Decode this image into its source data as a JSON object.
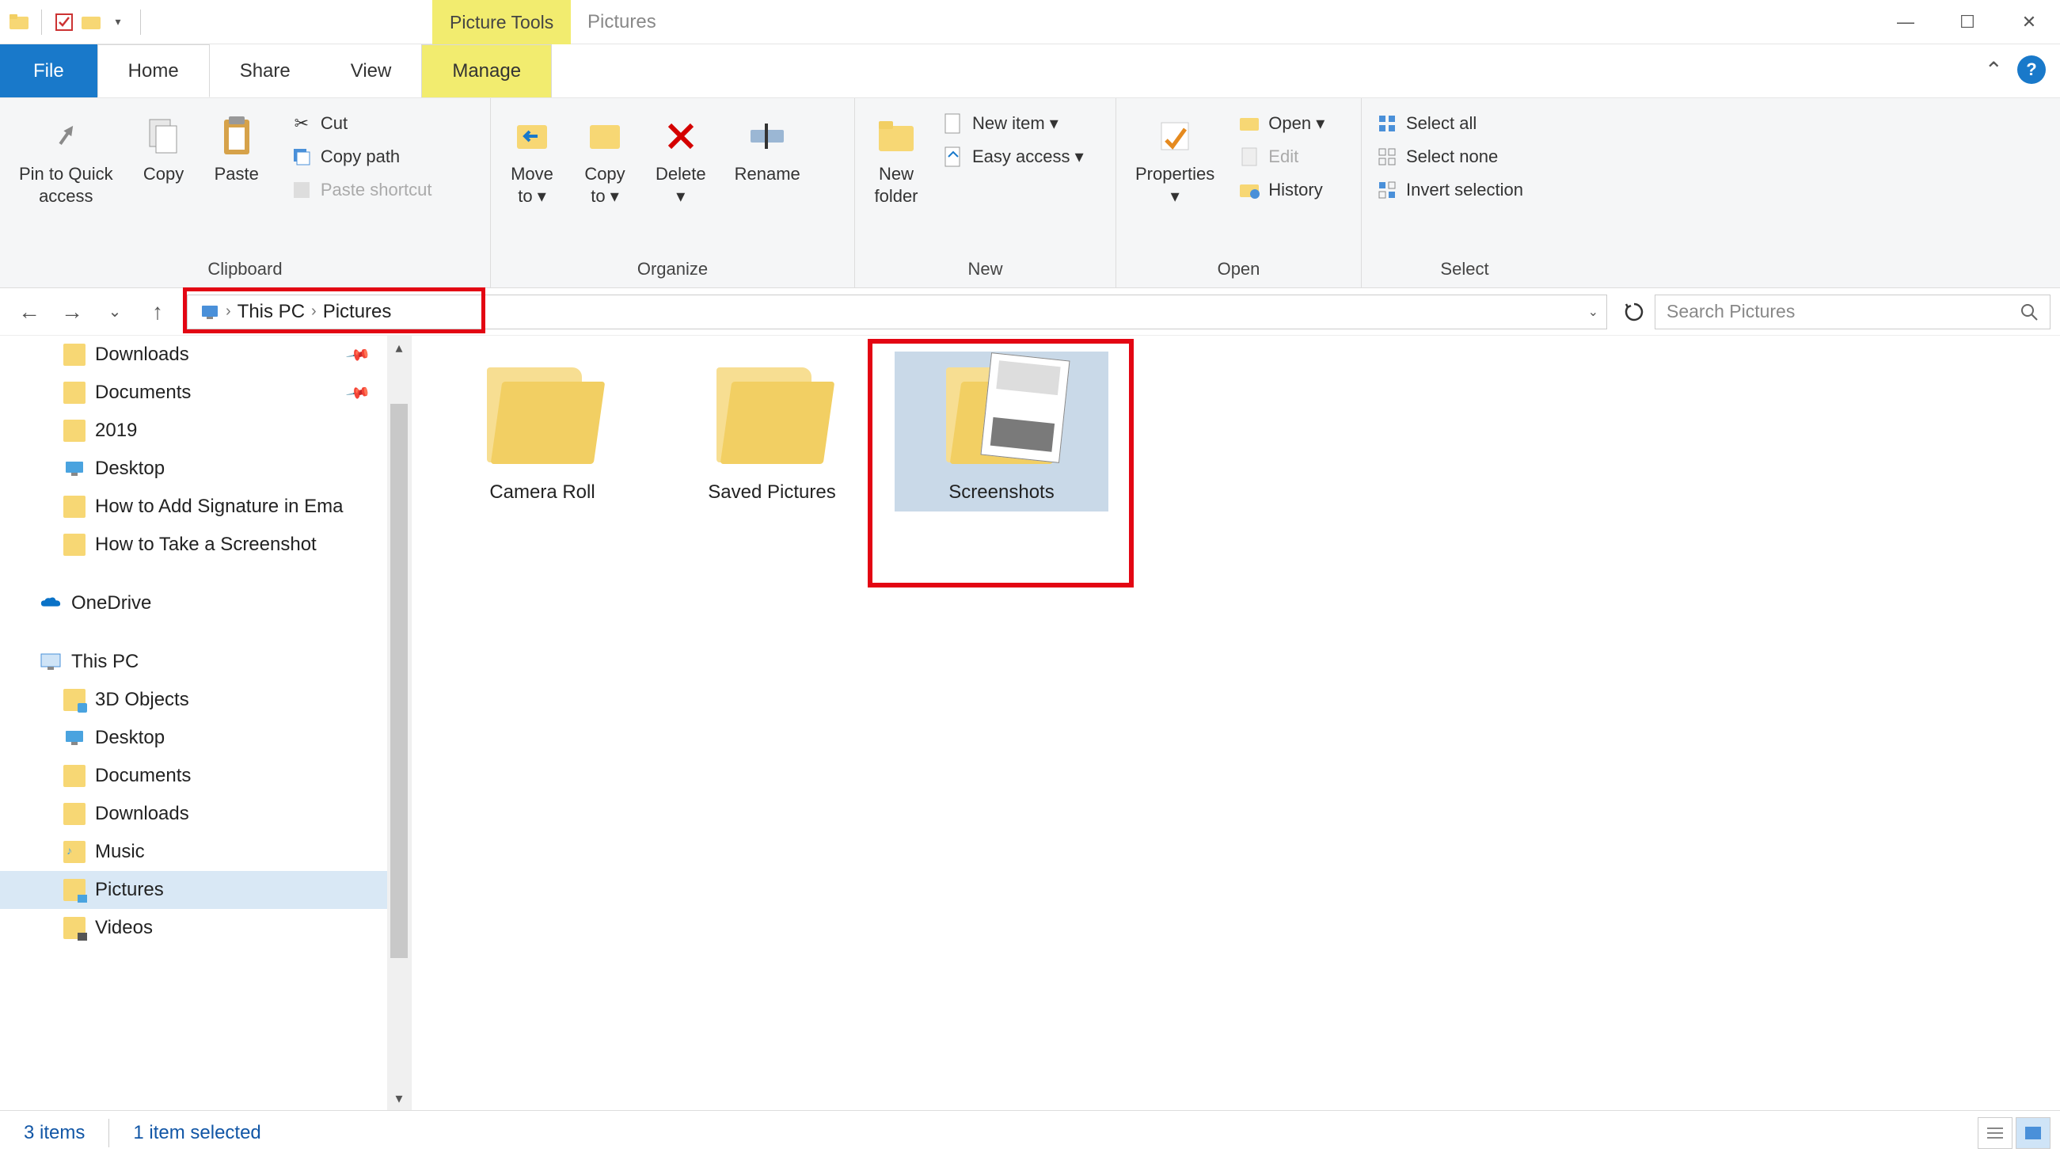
{
  "titlebar": {
    "context_tab": "Picture Tools",
    "context_title": "Pictures"
  },
  "tabs": {
    "file": "File",
    "home": "Home",
    "share": "Share",
    "view": "View",
    "manage": "Manage"
  },
  "ribbon": {
    "clipboard": {
      "label": "Clipboard",
      "pin": "Pin to Quick\naccess",
      "copy": "Copy",
      "paste": "Paste",
      "cut": "Cut",
      "copy_path": "Copy path",
      "paste_shortcut": "Paste shortcut"
    },
    "organize": {
      "label": "Organize",
      "move_to": "Move\nto ▾",
      "copy_to": "Copy\nto ▾",
      "delete": "Delete\n▾",
      "rename": "Rename"
    },
    "new": {
      "label": "New",
      "new_folder": "New\nfolder",
      "new_item": "New item ▾",
      "easy_access": "Easy access ▾"
    },
    "open": {
      "label": "Open",
      "properties": "Properties\n▾",
      "open": "Open ▾",
      "edit": "Edit",
      "history": "History"
    },
    "select": {
      "label": "Select",
      "select_all": "Select all",
      "select_none": "Select none",
      "invert": "Invert selection"
    }
  },
  "breadcrumb": {
    "this_pc": "This PC",
    "pictures": "Pictures"
  },
  "search": {
    "placeholder": "Search Pictures"
  },
  "tree": {
    "items": [
      {
        "label": "Downloads",
        "icon": "folder",
        "pinned": true,
        "level": 1
      },
      {
        "label": "Documents",
        "icon": "folder",
        "pinned": true,
        "level": 1
      },
      {
        "label": "2019",
        "icon": "folder",
        "level": 1
      },
      {
        "label": "Desktop",
        "icon": "desktop-blue",
        "level": 1
      },
      {
        "label": "How to Add Signature in Ema",
        "icon": "folder",
        "level": 1
      },
      {
        "label": "How to Take a Screenshot",
        "icon": "folder",
        "level": 1
      },
      {
        "label": "OneDrive",
        "icon": "onedrive",
        "level": 0,
        "spaced": true
      },
      {
        "label": "This PC",
        "icon": "thispc",
        "level": 0,
        "spaced": true
      },
      {
        "label": "3D Objects",
        "icon": "3d",
        "level": 1
      },
      {
        "label": "Desktop",
        "icon": "desktop-blue",
        "level": 1
      },
      {
        "label": "Documents",
        "icon": "folder",
        "level": 1
      },
      {
        "label": "Downloads",
        "icon": "folder",
        "level": 1
      },
      {
        "label": "Music",
        "icon": "music",
        "level": 1
      },
      {
        "label": "Pictures",
        "icon": "pictures",
        "level": 1,
        "selected": true
      },
      {
        "label": "Videos",
        "icon": "videos",
        "level": 1
      }
    ]
  },
  "content": {
    "folders": [
      {
        "label": "Camera Roll",
        "selected": false
      },
      {
        "label": "Saved Pictures",
        "selected": false
      },
      {
        "label": "Screenshots",
        "selected": true,
        "highlighted": true
      }
    ]
  },
  "status": {
    "items_count": "3 items",
    "selected_count": "1 item selected"
  }
}
